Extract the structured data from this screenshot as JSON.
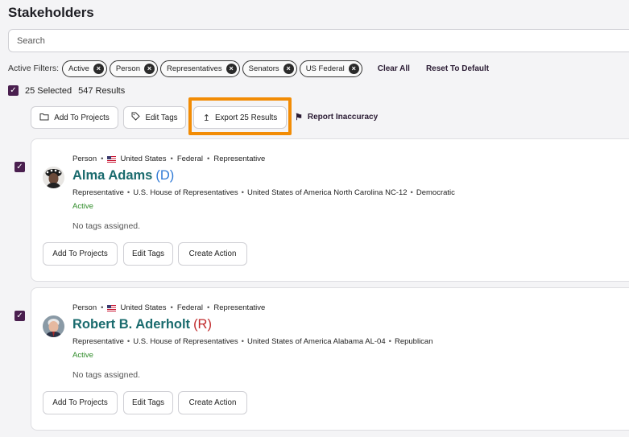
{
  "page_title": "Stakeholders",
  "search": {
    "placeholder": "Search",
    "value": ""
  },
  "filters": {
    "label": "Active Filters:",
    "chips": [
      "Active",
      "Person",
      "Representatives",
      "Senators",
      "US Federal"
    ],
    "clear_all": "Clear All",
    "reset": "Reset To Default"
  },
  "selection": {
    "selected": "25 Selected",
    "results": "547 Results"
  },
  "toolbar": {
    "add_to_projects": "Add To Projects",
    "edit_tags": "Edit Tags",
    "export": "Export 25 Results",
    "report": "Report Inaccuracy"
  },
  "highlight_color": "#f28c05",
  "stakeholders": [
    {
      "type": "Person",
      "country": "United States",
      "level": "Federal",
      "role": "Representative",
      "name": "Alma Adams",
      "party": "(D)",
      "party_color": "#2f7ad6",
      "details": [
        "Representative",
        "U.S. House of Representatives",
        "United States of America North Carolina NC-12",
        "Democratic"
      ],
      "status": "Active",
      "tags_text": "No tags assigned.",
      "actions": [
        "Add To Projects",
        "Edit Tags",
        "Create Action"
      ]
    },
    {
      "type": "Person",
      "country": "United States",
      "level": "Federal",
      "role": "Representative",
      "name": "Robert B. Aderholt",
      "party": "(R)",
      "party_color": "#c0292b",
      "details": [
        "Representative",
        "U.S. House of Representatives",
        "United States of America Alabama AL-04",
        "Republican"
      ],
      "status": "Active",
      "tags_text": "No tags assigned.",
      "actions": [
        "Add To Projects",
        "Edit Tags",
        "Create Action"
      ]
    }
  ]
}
